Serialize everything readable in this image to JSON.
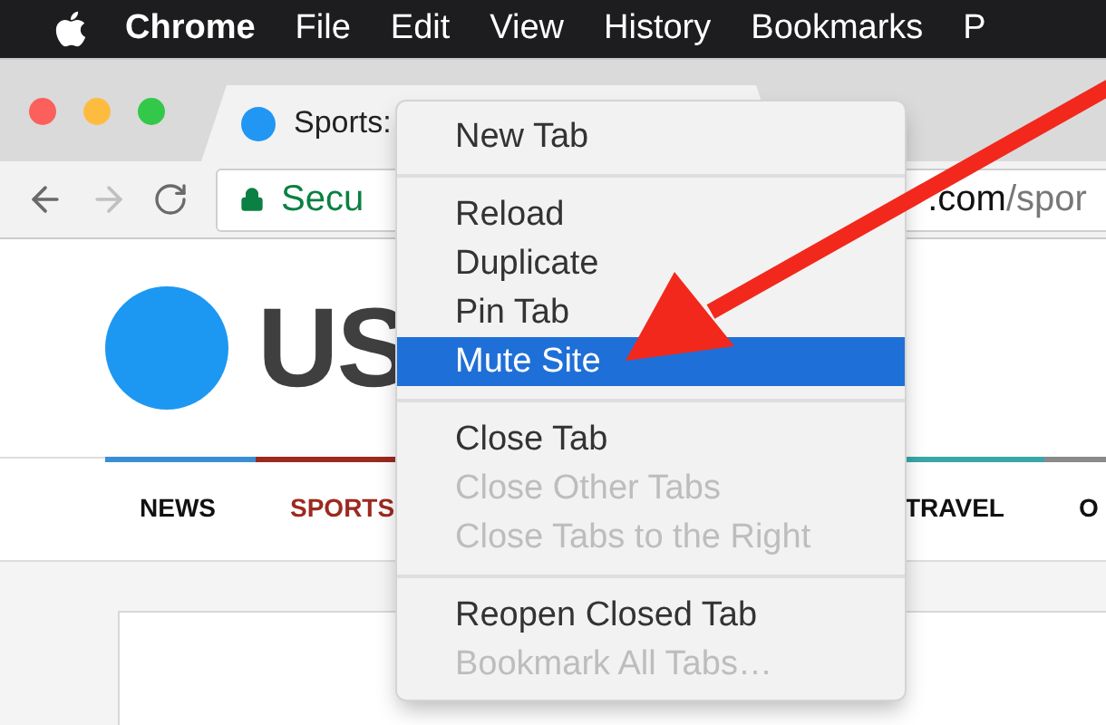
{
  "menu_bar": {
    "items": [
      {
        "label": "Chrome",
        "kind": "app"
      },
      {
        "label": "File",
        "kind": "menu"
      },
      {
        "label": "Edit",
        "kind": "menu"
      },
      {
        "label": "View",
        "kind": "menu"
      },
      {
        "label": "History",
        "kind": "menu"
      },
      {
        "label": "Bookmarks",
        "kind": "menu"
      },
      {
        "label": "P",
        "kind": "menu"
      }
    ]
  },
  "tab": {
    "title": "Sports:"
  },
  "address_bar": {
    "security": "Secu",
    "host": ".com",
    "path": "/spor"
  },
  "page": {
    "logo_text": "US",
    "nav_left": [
      {
        "label": "NEWS",
        "selected": false,
        "color": "#3a8fd4"
      },
      {
        "label": "SPORTS",
        "selected": true,
        "color": "#9b2a1f"
      }
    ],
    "nav_right": [
      {
        "label": "TRAVEL",
        "selected": false,
        "color": "#3aa6a8"
      },
      {
        "label": "O",
        "selected": false,
        "color": "#8a8a8a"
      }
    ]
  },
  "context_menu": {
    "groups": [
      [
        {
          "label": "New Tab",
          "disabled": false,
          "selected": false
        }
      ],
      [
        {
          "label": "Reload",
          "disabled": false,
          "selected": false
        },
        {
          "label": "Duplicate",
          "disabled": false,
          "selected": false
        },
        {
          "label": "Pin Tab",
          "disabled": false,
          "selected": false
        },
        {
          "label": "Mute Site",
          "disabled": false,
          "selected": true
        }
      ],
      [
        {
          "label": "Close Tab",
          "disabled": false,
          "selected": false
        },
        {
          "label": "Close Other Tabs",
          "disabled": true,
          "selected": false
        },
        {
          "label": "Close Tabs to the Right",
          "disabled": true,
          "selected": false
        }
      ],
      [
        {
          "label": "Reopen Closed Tab",
          "disabled": false,
          "selected": false
        },
        {
          "label": "Bookmark All Tabs…",
          "disabled": true,
          "selected": false
        }
      ]
    ]
  }
}
